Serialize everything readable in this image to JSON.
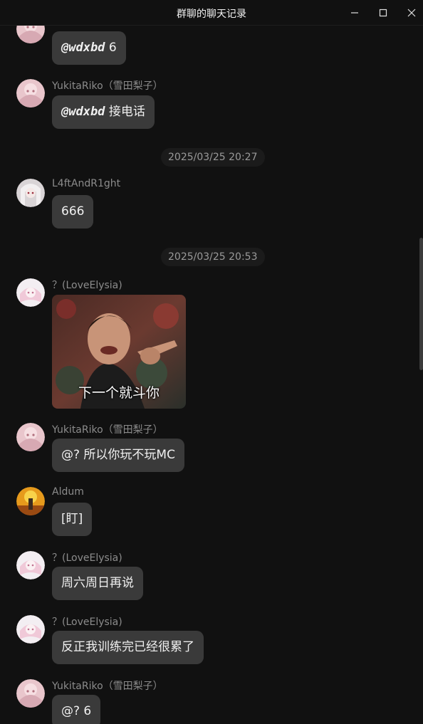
{
  "window": {
    "title": "群聊的聊天记录"
  },
  "colors": {
    "background": "#111111",
    "bubble": "#3a3a3a",
    "sender_text": "#8c8c8c",
    "timestamp_text": "#9a9a9a"
  },
  "timestamps": [
    "2025/03/25 20:27",
    "2025/03/25 20:53"
  ],
  "messages": [
    {
      "avatar": "pink-anime-avatar",
      "mention": "@wdxbd",
      "text": " 6"
    },
    {
      "sender": "YukitaRiko（雪田梨子）",
      "avatar": "pink-anime-avatar",
      "mention": "@wdxbd",
      "text": " 接电话"
    },
    {
      "sender": "L4ftAndR1ght",
      "avatar": "white-hair-avatar",
      "text": "666"
    },
    {
      "sender": "？(LoveElysia)",
      "avatar": "elysia-avatar",
      "sticker_caption": "下一个就斗你"
    },
    {
      "sender": "YukitaRiko（雪田梨子）",
      "avatar": "pink-anime-avatar",
      "text": "@? 所以你玩不玩MC"
    },
    {
      "sender": "Aldum",
      "avatar": "sunset-avatar",
      "text": "[盯]"
    },
    {
      "sender": "？(LoveElysia)",
      "avatar": "elysia-avatar",
      "text": "周六周日再说"
    },
    {
      "sender": "？(LoveElysia)",
      "avatar": "elysia-avatar",
      "text": "反正我训练完已经很累了"
    },
    {
      "sender": "YukitaRiko（雪田梨子）",
      "avatar": "pink-anime-avatar",
      "text": "@? 6"
    }
  ]
}
